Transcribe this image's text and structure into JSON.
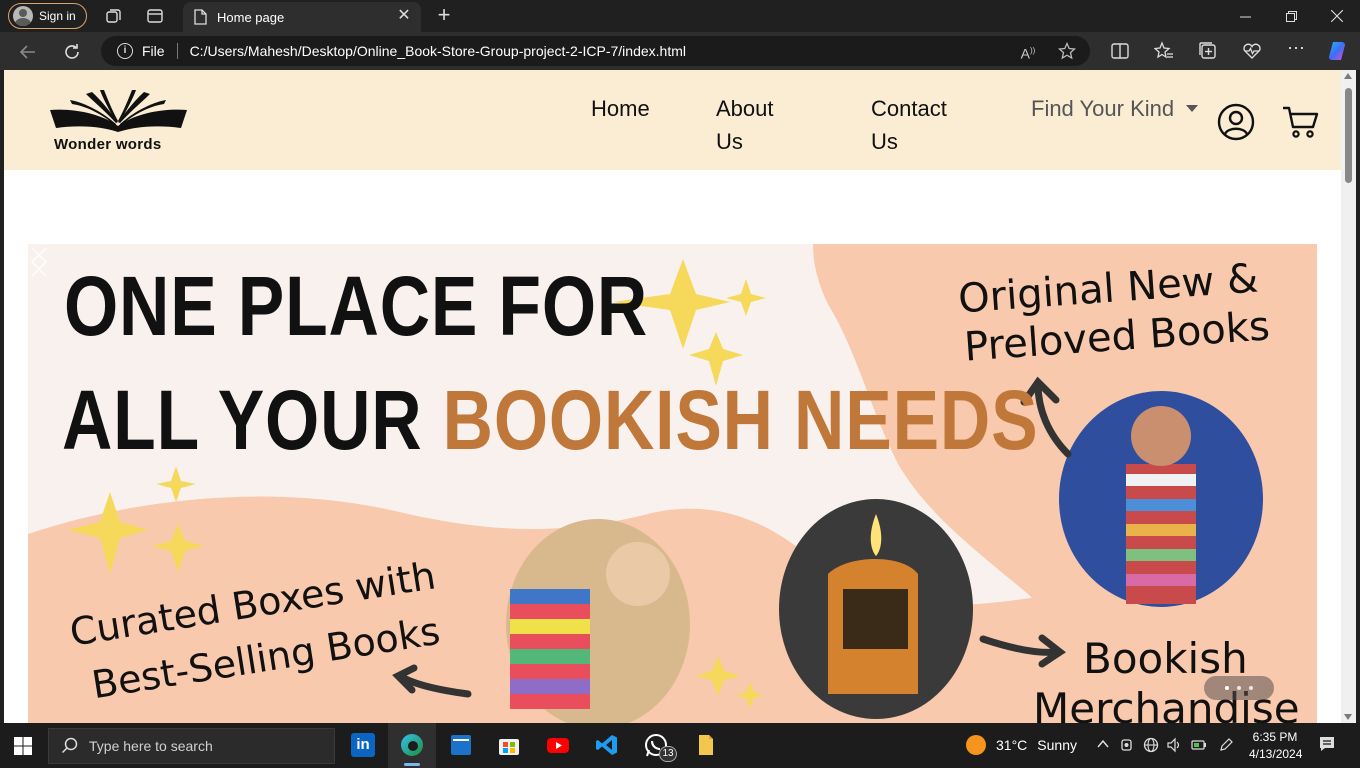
{
  "browser": {
    "signin_label": "Sign in",
    "tab_title": "Home page",
    "tab_close_glyph": "✕",
    "newtab_glyph": "+",
    "address_prefix": "File",
    "url": "C:/Users/Mahesh/Desktop/Online_Book-Store-Group-project-2-ICP-7/index.html"
  },
  "site": {
    "logo_text": "Wonder words",
    "nav": [
      {
        "line1": "Home",
        "line2": ""
      },
      {
        "line1": "About",
        "line2": "Us"
      },
      {
        "line1": "Contact",
        "line2": "Us"
      }
    ],
    "dropdown_label": "Find Your Kind"
  },
  "hero": {
    "line1": "ONE PLACE FOR",
    "line2_plain": "ALL YOUR ",
    "line2_accent": "BOOKISH NEEDS",
    "tag_top_right_1": "Original New &",
    "tag_top_right_2": "Preloved Books",
    "tag_bottom_left_1": "Curated Boxes with",
    "tag_bottom_left_2": "Best-Selling Books",
    "tag_bottom_right_1": "Bookish",
    "tag_bottom_right_2": "Merchandise",
    "accent_color": "#c0773a",
    "peach_color": "#f8c9ac",
    "star_color": "#f6d95a"
  },
  "taskbar": {
    "search_placeholder": "Type here to search",
    "whatsapp_badge": "13",
    "temperature": "31°C",
    "weather": "Sunny",
    "time": "6:35 PM",
    "date": "4/13/2024"
  }
}
